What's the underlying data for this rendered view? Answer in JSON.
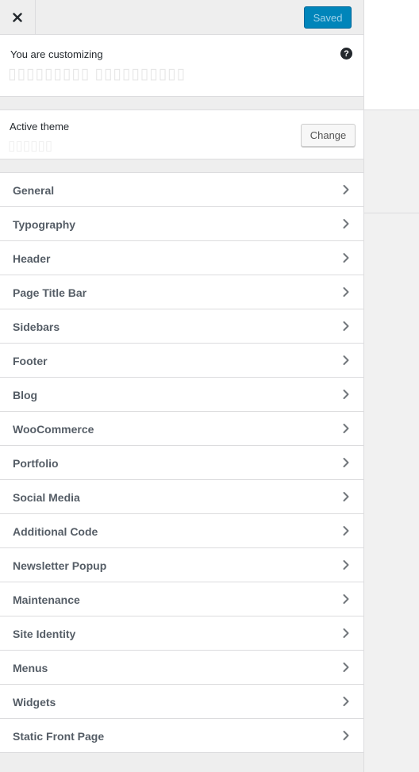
{
  "topbar": {
    "close_icon": "close-icon",
    "saved_label": "Saved"
  },
  "info": {
    "label": "You are customizing",
    "site_title": "▯▯▯▯▯▯▯▯▯ ▯▯▯▯▯▯▯▯▯▯",
    "help_icon": "help-icon"
  },
  "theme": {
    "label": "Active theme",
    "name": "▯▯▯▯▯▯",
    "change_label": "Change"
  },
  "menu": {
    "items": [
      {
        "label": "General"
      },
      {
        "label": "Typography"
      },
      {
        "label": "Header"
      },
      {
        "label": "Page Title Bar"
      },
      {
        "label": "Sidebars"
      },
      {
        "label": "Footer"
      },
      {
        "label": "Blog"
      },
      {
        "label": "WooCommerce"
      },
      {
        "label": "Portfolio"
      },
      {
        "label": "Social Media"
      },
      {
        "label": "Additional Code"
      },
      {
        "label": "Newsletter Popup"
      },
      {
        "label": "Maintenance"
      },
      {
        "label": "Site Identity"
      },
      {
        "label": "Menus"
      },
      {
        "label": "Widgets"
      },
      {
        "label": "Static Front Page"
      }
    ],
    "chevron_icon": "chevron-right-icon"
  },
  "colors": {
    "accent": "#0085ba",
    "panel_bg": "#eeeeee",
    "border": "#dcdcde",
    "menu_text": "#555d66"
  }
}
